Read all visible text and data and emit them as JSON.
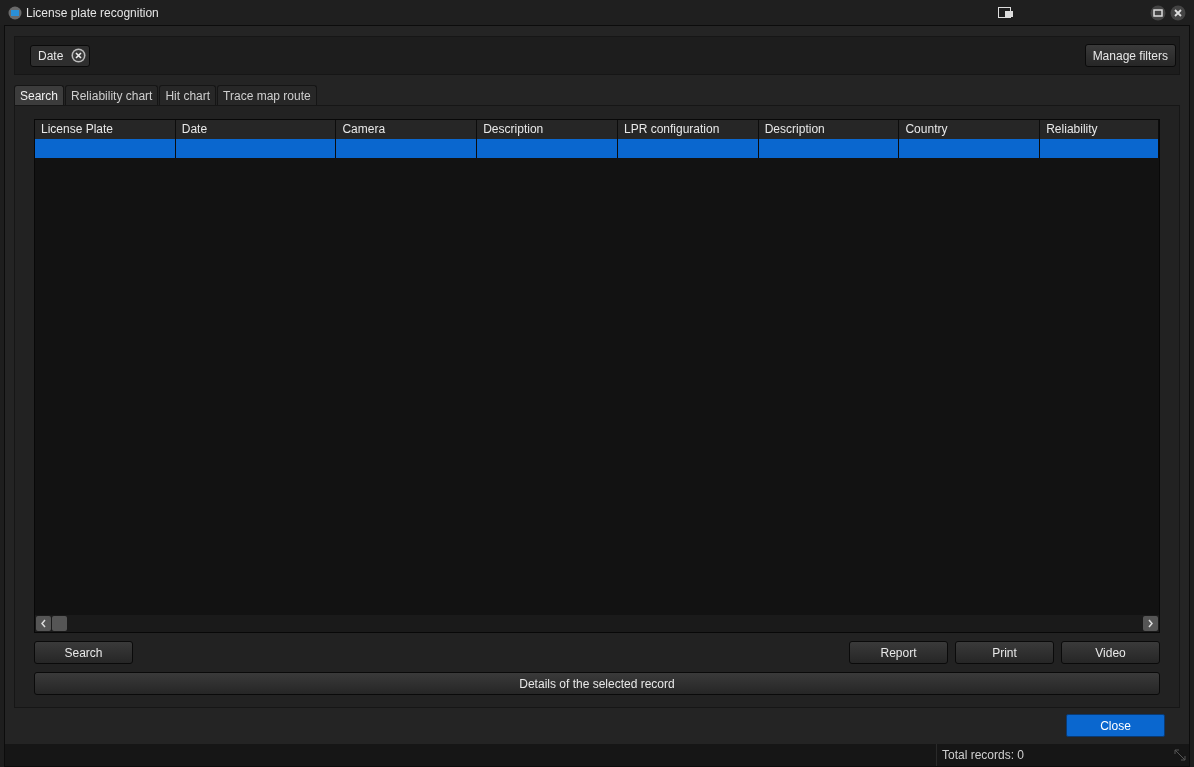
{
  "window": {
    "title": "License plate recognition"
  },
  "filters": {
    "chips": [
      {
        "label": "Date"
      }
    ],
    "manage_button": "Manage filters"
  },
  "tabs": [
    {
      "label": "Search",
      "selected": true
    },
    {
      "label": "Reliability chart",
      "selected": false
    },
    {
      "label": "Hit chart",
      "selected": false
    },
    {
      "label": "Trace map route",
      "selected": false
    }
  ],
  "table": {
    "columns": [
      "License Plate",
      "Date",
      "Camera",
      "Description",
      "LPR configuration",
      "Description",
      "Country",
      "Reliability"
    ],
    "rows": [
      {
        "selected": true
      }
    ]
  },
  "actions": {
    "left": [
      "Search"
    ],
    "right": [
      "Report",
      "Print",
      "Video"
    ]
  },
  "details_button": "Details of the selected record",
  "close_button": "Close",
  "status_bar": {
    "total": "Total records: 0"
  }
}
